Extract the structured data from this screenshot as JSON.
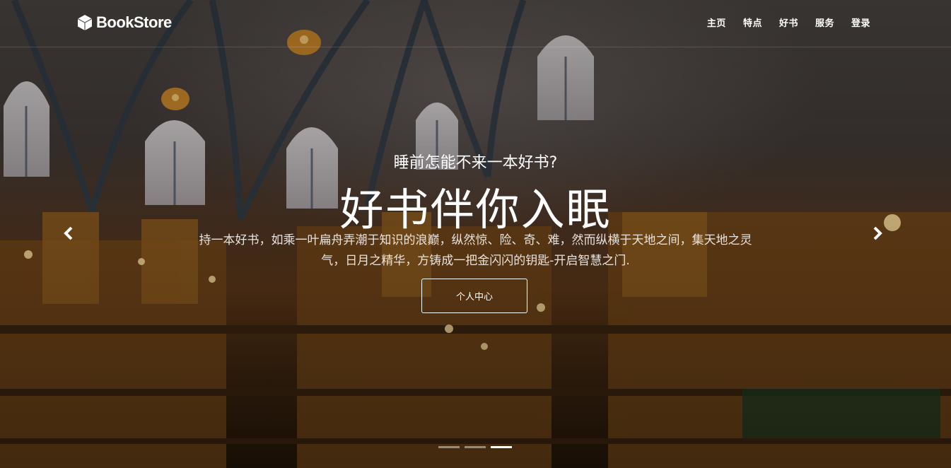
{
  "navbar": {
    "brand": "BookStore",
    "links": [
      "主页",
      "特点",
      "好书",
      "服务",
      "登录"
    ]
  },
  "hero": {
    "subtitle": "睡前怎能不来一本好书?",
    "title": "好书伴你入眠",
    "description": "持一本好书，如乘一叶扁舟弄潮于知识的浪巅，纵然惊、险、奇、难，然而纵横于天地之间，集天地之灵气，日月之精华，方铸成一把金闪闪的钥匙-开启智慧之门.",
    "cta_label": "个人中心"
  },
  "carousel": {
    "slides": 3,
    "active_index": 2
  },
  "icons": {
    "brand_icon": "cube-icon",
    "prev": "chevron-left-icon",
    "next": "chevron-right-icon"
  }
}
